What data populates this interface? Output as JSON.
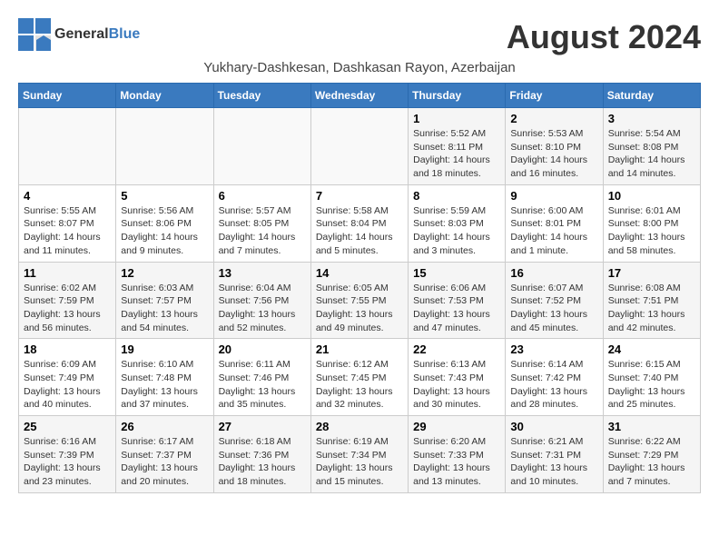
{
  "logo": {
    "general": "General",
    "blue": "Blue"
  },
  "title": "August 2024",
  "subtitle": "Yukhary-Dashkesan, Dashkasan Rayon, Azerbaijan",
  "headers": [
    "Sunday",
    "Monday",
    "Tuesday",
    "Wednesday",
    "Thursday",
    "Friday",
    "Saturday"
  ],
  "weeks": [
    [
      {
        "day": "",
        "info": ""
      },
      {
        "day": "",
        "info": ""
      },
      {
        "day": "",
        "info": ""
      },
      {
        "day": "",
        "info": ""
      },
      {
        "day": "1",
        "info": "Sunrise: 5:52 AM\nSunset: 8:11 PM\nDaylight: 14 hours\nand 18 minutes."
      },
      {
        "day": "2",
        "info": "Sunrise: 5:53 AM\nSunset: 8:10 PM\nDaylight: 14 hours\nand 16 minutes."
      },
      {
        "day": "3",
        "info": "Sunrise: 5:54 AM\nSunset: 8:08 PM\nDaylight: 14 hours\nand 14 minutes."
      }
    ],
    [
      {
        "day": "4",
        "info": "Sunrise: 5:55 AM\nSunset: 8:07 PM\nDaylight: 14 hours\nand 11 minutes."
      },
      {
        "day": "5",
        "info": "Sunrise: 5:56 AM\nSunset: 8:06 PM\nDaylight: 14 hours\nand 9 minutes."
      },
      {
        "day": "6",
        "info": "Sunrise: 5:57 AM\nSunset: 8:05 PM\nDaylight: 14 hours\nand 7 minutes."
      },
      {
        "day": "7",
        "info": "Sunrise: 5:58 AM\nSunset: 8:04 PM\nDaylight: 14 hours\nand 5 minutes."
      },
      {
        "day": "8",
        "info": "Sunrise: 5:59 AM\nSunset: 8:03 PM\nDaylight: 14 hours\nand 3 minutes."
      },
      {
        "day": "9",
        "info": "Sunrise: 6:00 AM\nSunset: 8:01 PM\nDaylight: 14 hours\nand 1 minute."
      },
      {
        "day": "10",
        "info": "Sunrise: 6:01 AM\nSunset: 8:00 PM\nDaylight: 13 hours\nand 58 minutes."
      }
    ],
    [
      {
        "day": "11",
        "info": "Sunrise: 6:02 AM\nSunset: 7:59 PM\nDaylight: 13 hours\nand 56 minutes."
      },
      {
        "day": "12",
        "info": "Sunrise: 6:03 AM\nSunset: 7:57 PM\nDaylight: 13 hours\nand 54 minutes."
      },
      {
        "day": "13",
        "info": "Sunrise: 6:04 AM\nSunset: 7:56 PM\nDaylight: 13 hours\nand 52 minutes."
      },
      {
        "day": "14",
        "info": "Sunrise: 6:05 AM\nSunset: 7:55 PM\nDaylight: 13 hours\nand 49 minutes."
      },
      {
        "day": "15",
        "info": "Sunrise: 6:06 AM\nSunset: 7:53 PM\nDaylight: 13 hours\nand 47 minutes."
      },
      {
        "day": "16",
        "info": "Sunrise: 6:07 AM\nSunset: 7:52 PM\nDaylight: 13 hours\nand 45 minutes."
      },
      {
        "day": "17",
        "info": "Sunrise: 6:08 AM\nSunset: 7:51 PM\nDaylight: 13 hours\nand 42 minutes."
      }
    ],
    [
      {
        "day": "18",
        "info": "Sunrise: 6:09 AM\nSunset: 7:49 PM\nDaylight: 13 hours\nand 40 minutes."
      },
      {
        "day": "19",
        "info": "Sunrise: 6:10 AM\nSunset: 7:48 PM\nDaylight: 13 hours\nand 37 minutes."
      },
      {
        "day": "20",
        "info": "Sunrise: 6:11 AM\nSunset: 7:46 PM\nDaylight: 13 hours\nand 35 minutes."
      },
      {
        "day": "21",
        "info": "Sunrise: 6:12 AM\nSunset: 7:45 PM\nDaylight: 13 hours\nand 32 minutes."
      },
      {
        "day": "22",
        "info": "Sunrise: 6:13 AM\nSunset: 7:43 PM\nDaylight: 13 hours\nand 30 minutes."
      },
      {
        "day": "23",
        "info": "Sunrise: 6:14 AM\nSunset: 7:42 PM\nDaylight: 13 hours\nand 28 minutes."
      },
      {
        "day": "24",
        "info": "Sunrise: 6:15 AM\nSunset: 7:40 PM\nDaylight: 13 hours\nand 25 minutes."
      }
    ],
    [
      {
        "day": "25",
        "info": "Sunrise: 6:16 AM\nSunset: 7:39 PM\nDaylight: 13 hours\nand 23 minutes."
      },
      {
        "day": "26",
        "info": "Sunrise: 6:17 AM\nSunset: 7:37 PM\nDaylight: 13 hours\nand 20 minutes."
      },
      {
        "day": "27",
        "info": "Sunrise: 6:18 AM\nSunset: 7:36 PM\nDaylight: 13 hours\nand 18 minutes."
      },
      {
        "day": "28",
        "info": "Sunrise: 6:19 AM\nSunset: 7:34 PM\nDaylight: 13 hours\nand 15 minutes."
      },
      {
        "day": "29",
        "info": "Sunrise: 6:20 AM\nSunset: 7:33 PM\nDaylight: 13 hours\nand 13 minutes."
      },
      {
        "day": "30",
        "info": "Sunrise: 6:21 AM\nSunset: 7:31 PM\nDaylight: 13 hours\nand 10 minutes."
      },
      {
        "day": "31",
        "info": "Sunrise: 6:22 AM\nSunset: 7:29 PM\nDaylight: 13 hours\nand 7 minutes."
      }
    ]
  ]
}
